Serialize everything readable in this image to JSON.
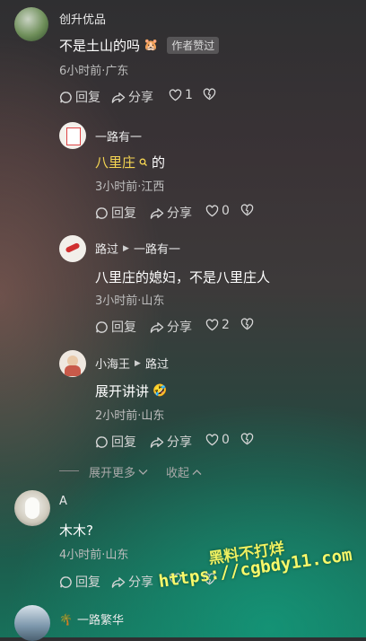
{
  "comments": [
    {
      "author": "创升优品",
      "text": "不是土山的吗",
      "emoji": "🐹",
      "badge": "作者赞过",
      "meta": "6小时前·广东",
      "reply_label": "回复",
      "share_label": "分享",
      "like_count": "1"
    },
    {
      "author": "一路有一",
      "text_highlight": "八里庄",
      "text_rest": "的",
      "meta": "3小时前·江西",
      "reply_label": "回复",
      "share_label": "分享",
      "like_count": "0"
    },
    {
      "author": "路过",
      "reply_to": "一路有一",
      "text": "八里庄的媳妇，不是八里庄人",
      "meta": "3小时前·山东",
      "reply_label": "回复",
      "share_label": "分享",
      "like_count": "2"
    },
    {
      "author": "小海王",
      "reply_to": "路过",
      "text": "展开讲讲",
      "emoji": "🤣",
      "meta": "2小时前·山东",
      "reply_label": "回复",
      "share_label": "分享",
      "like_count": "0"
    },
    {
      "author": "A",
      "text": "木木?",
      "meta": "4小时前·山东",
      "reply_label": "回复",
      "share_label": "分享"
    },
    {
      "author_icon": "🌴",
      "author": "一路繁华"
    }
  ],
  "thread_controls": {
    "expand_more": "展开更多",
    "collapse": "收起"
  },
  "watermark": {
    "line1": "黑料不打烊",
    "line2": "https://cgbdy11.com"
  },
  "colors": {
    "highlight": "#f5d552",
    "text": "#ffffff",
    "meta": "#bdbdbd"
  }
}
